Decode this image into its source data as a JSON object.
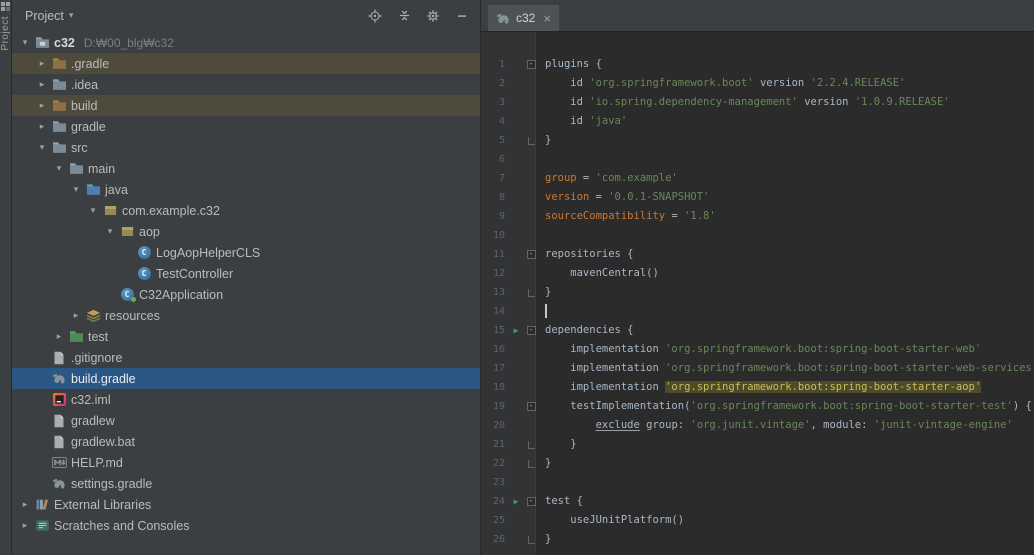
{
  "colors": {
    "panel_bg": "#3C3F41",
    "editor_bg": "#2B2B2B",
    "tab_active_bg": "#4E5254",
    "selection_blue": "#2A5784",
    "excluded_row": "#4F4B3C",
    "run_green": "#499C54",
    "plain_text": "#A9B7C6",
    "string": "#6A8759",
    "keyword": "#CC7832",
    "highlight_text": "#C8BD61",
    "highlight_bg": "#4E4B27",
    "line_number": "#606366",
    "tree_text": "#BBBBBB",
    "tree_hint": "#7C7F83"
  },
  "stripe": {
    "top_icon": "tool-windows-grid",
    "button_label": "Project"
  },
  "project_panel": {
    "header": {
      "title": "Project",
      "dropdown_caret": "▾",
      "icons": [
        "locate-opened-file",
        "collapse-all",
        "settings",
        "hide"
      ]
    },
    "tree": [
      {
        "label": "c32",
        "hint": "D:₩00_blg₩c32",
        "level": 0,
        "icon": "project-folder",
        "state": "expanded",
        "bold": true
      },
      {
        "label": ".gradle",
        "level": 1,
        "icon": "excluded-folder",
        "state": "collapsed",
        "row": "excluded"
      },
      {
        "label": ".idea",
        "level": 1,
        "icon": "folder",
        "state": "collapsed"
      },
      {
        "label": "build",
        "level": 1,
        "icon": "excluded-folder",
        "state": "collapsed",
        "row": "excluded"
      },
      {
        "label": "gradle",
        "level": 1,
        "icon": "folder",
        "state": "collapsed"
      },
      {
        "label": "src",
        "level": 1,
        "icon": "folder",
        "state": "expanded"
      },
      {
        "label": "main",
        "level": 2,
        "icon": "folder",
        "state": "expanded"
      },
      {
        "label": "java",
        "level": 3,
        "icon": "source-folder",
        "state": "expanded"
      },
      {
        "label": "com.example.c32",
        "level": 4,
        "icon": "package",
        "state": "expanded"
      },
      {
        "label": "aop",
        "level": 5,
        "icon": "package",
        "state": "expanded"
      },
      {
        "label": "LogAopHelperCLS",
        "level": 6,
        "icon": "class"
      },
      {
        "label": "TestController",
        "level": 6,
        "icon": "class"
      },
      {
        "label": "C32Application",
        "level": 5,
        "icon": "class-main"
      },
      {
        "label": "resources",
        "level": 3,
        "icon": "resources-folder",
        "state": "collapsed"
      },
      {
        "label": "test",
        "level": 2,
        "icon": "test-folder",
        "state": "collapsed"
      },
      {
        "label": ".gitignore",
        "level": 1,
        "icon": "file"
      },
      {
        "label": "build.gradle",
        "level": 1,
        "icon": "gradle",
        "row": "selected"
      },
      {
        "label": "c32.iml",
        "level": 1,
        "icon": "iml"
      },
      {
        "label": "gradlew",
        "level": 1,
        "icon": "file"
      },
      {
        "label": "gradlew.bat",
        "level": 1,
        "icon": "file"
      },
      {
        "label": "HELP.md",
        "level": 1,
        "icon": "markdown"
      },
      {
        "label": "settings.gradle",
        "level": 1,
        "icon": "gradle"
      },
      {
        "label": "External Libraries",
        "level": 0,
        "icon": "libraries",
        "state": "collapsed"
      },
      {
        "label": "Scratches and Consoles",
        "level": 0,
        "icon": "scratches",
        "state": "collapsed"
      }
    ]
  },
  "editor": {
    "tab": {
      "label": "c32",
      "icon": "gradle",
      "close": "×"
    },
    "code": {
      "caret_line": 14,
      "lines": [
        {
          "n": 1,
          "fold": "start",
          "tokens": [
            [
              "p",
              "plugins {"
            ]
          ]
        },
        {
          "n": 2,
          "tokens": [
            [
              "p",
              "    id "
            ],
            [
              "s",
              "'org.springframework.boot'"
            ],
            [
              "p",
              " version "
            ],
            [
              "s",
              "'2.2.4.RELEASE'"
            ]
          ]
        },
        {
          "n": 3,
          "tokens": [
            [
              "p",
              "    id "
            ],
            [
              "s",
              "'io.spring.dependency-management'"
            ],
            [
              "p",
              " version "
            ],
            [
              "s",
              "'1.0.9.RELEASE'"
            ]
          ]
        },
        {
          "n": 4,
          "tokens": [
            [
              "p",
              "    id "
            ],
            [
              "s",
              "'java'"
            ]
          ]
        },
        {
          "n": 5,
          "fold": "end",
          "tokens": [
            [
              "p",
              "}"
            ]
          ]
        },
        {
          "n": 6,
          "tokens": []
        },
        {
          "n": 7,
          "tokens": [
            [
              "k",
              "group"
            ],
            [
              "p",
              " = "
            ],
            [
              "s",
              "'com.example'"
            ]
          ]
        },
        {
          "n": 8,
          "tokens": [
            [
              "k",
              "version"
            ],
            [
              "p",
              " = "
            ],
            [
              "s",
              "'0.0.1-SNAPSHOT'"
            ]
          ]
        },
        {
          "n": 9,
          "tokens": [
            [
              "k",
              "sourceCompatibility"
            ],
            [
              "p",
              " = "
            ],
            [
              "s",
              "'1.8'"
            ]
          ]
        },
        {
          "n": 10,
          "tokens": []
        },
        {
          "n": 11,
          "fold": "start",
          "tokens": [
            [
              "p",
              "repositories {"
            ]
          ]
        },
        {
          "n": 12,
          "tokens": [
            [
              "p",
              "    mavenCentral()"
            ]
          ]
        },
        {
          "n": 13,
          "fold": "end",
          "tokens": [
            [
              "p",
              "}"
            ]
          ]
        },
        {
          "n": 14,
          "tokens": []
        },
        {
          "n": 15,
          "fold": "start",
          "run": true,
          "tokens": [
            [
              "p",
              "dependencies {"
            ]
          ]
        },
        {
          "n": 16,
          "tokens": [
            [
              "p",
              "    implementation "
            ],
            [
              "s",
              "'org.springframework.boot:spring-boot-starter-web'"
            ]
          ]
        },
        {
          "n": 17,
          "tokens": [
            [
              "p",
              "    implementation "
            ],
            [
              "s",
              "'org.springframework.boot:spring-boot-starter-web-services'"
            ]
          ]
        },
        {
          "n": 18,
          "tokens": [
            [
              "p",
              "    implementation "
            ],
            [
              "sh",
              "'org.springframework.boot:spring-boot-starter-aop'"
            ]
          ]
        },
        {
          "n": 19,
          "fold": "start",
          "tokens": [
            [
              "p",
              "    testImplementation("
            ],
            [
              "s",
              "'org.springframework.boot:spring-boot-starter-test'"
            ],
            [
              "p",
              ") {"
            ]
          ]
        },
        {
          "n": 20,
          "tokens": [
            [
              "p",
              "        "
            ],
            [
              "u",
              "exclude"
            ],
            [
              "p",
              " group: "
            ],
            [
              "s",
              "'org.junit.vintage'"
            ],
            [
              "p",
              ", module: "
            ],
            [
              "s",
              "'junit-vintage-engine'"
            ]
          ]
        },
        {
          "n": 21,
          "fold": "end",
          "tokens": [
            [
              "p",
              "    }"
            ]
          ]
        },
        {
          "n": 22,
          "fold": "end",
          "tokens": [
            [
              "p",
              "}"
            ]
          ]
        },
        {
          "n": 23,
          "tokens": []
        },
        {
          "n": 24,
          "fold": "start",
          "run": true,
          "tokens": [
            [
              "p",
              "test {"
            ]
          ]
        },
        {
          "n": 25,
          "tokens": [
            [
              "p",
              "    useJUnitPlatform()"
            ]
          ]
        },
        {
          "n": 26,
          "fold": "end",
          "tokens": [
            [
              "p",
              "}"
            ]
          ]
        }
      ]
    }
  }
}
